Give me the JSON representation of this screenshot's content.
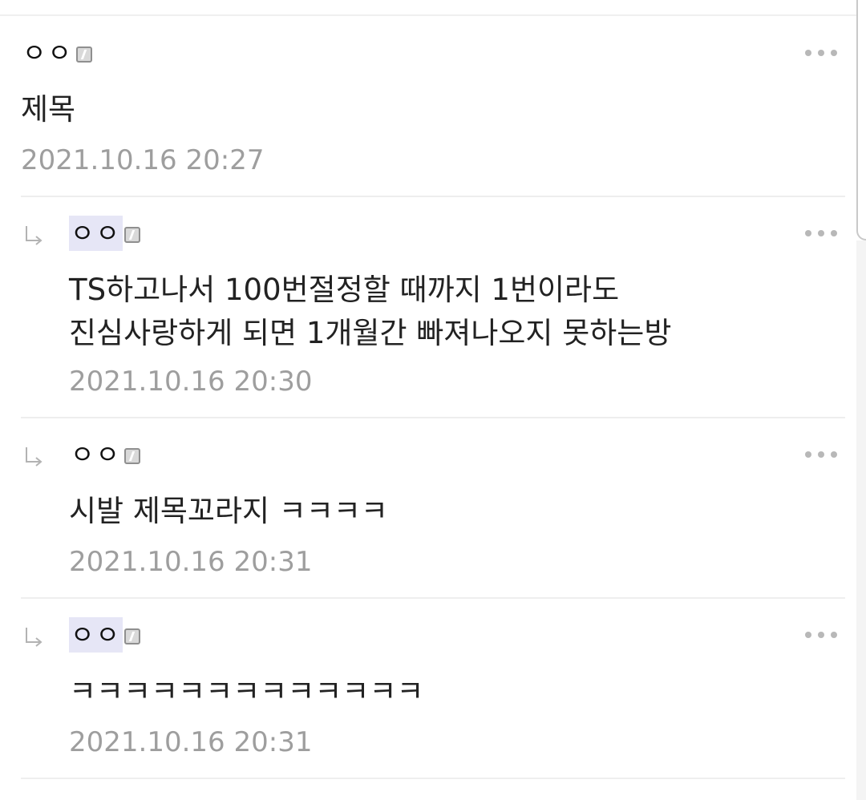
{
  "comments": [
    {
      "nickname": "ㅇㅇ",
      "text": "제목",
      "time": "2021.10.16 20:27",
      "reply": false,
      "nick_highlight": false
    },
    {
      "nickname": "ㅇㅇ",
      "text": "TS하고나서 100번절정할 때까지 1번이라도\n진심사랑하게 되면 1개월간 빠져나오지 못하는방",
      "time": "2021.10.16 20:30",
      "reply": true,
      "nick_highlight": true
    },
    {
      "nickname": "ㅇㅇ",
      "text": "시발 제목꼬라지 ㅋㅋㅋㅋ",
      "time": "2021.10.16 20:31",
      "reply": true,
      "nick_highlight": false
    },
    {
      "nickname": "ㅇㅇ",
      "text": "ㅋㅋㅋㅋㅋㅋㅋㅋㅋㅋㅋㅋㅋ",
      "time": "2021.10.16 20:31",
      "reply": true,
      "nick_highlight": true
    }
  ],
  "icons": {
    "reply": "reply-arrow-icon",
    "more": "more-options-icon",
    "badge": "fixed-nick-badge-icon"
  },
  "colors": {
    "nick_highlight": "#e6e6f6",
    "timestamp": "#9e9e9e",
    "divider": "#eeeeee"
  }
}
